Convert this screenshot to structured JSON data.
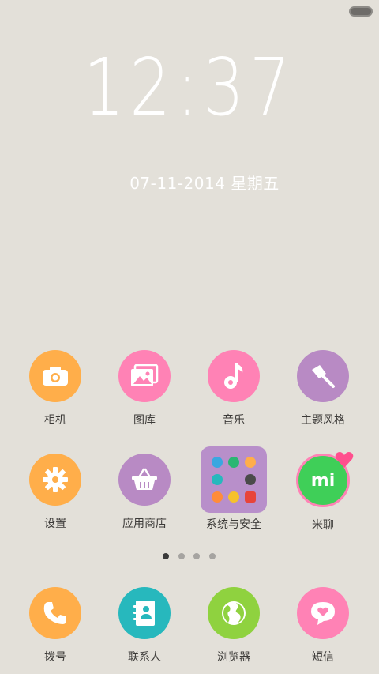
{
  "status": {
    "battery_icon": "battery-icon"
  },
  "lock": {
    "time": "12:37",
    "date": "07-11-2014 星期五"
  },
  "apps": [
    {
      "id": "camera",
      "label": "相机",
      "color": "#ffae4a",
      "icon": "camera-icon"
    },
    {
      "id": "gallery",
      "label": "图库",
      "color": "#ff82b5",
      "icon": "gallery-icon"
    },
    {
      "id": "music",
      "label": "音乐",
      "color": "#ff82b5",
      "icon": "music-note-icon"
    },
    {
      "id": "themes",
      "label": "主题风格",
      "color": "#b88ac4",
      "icon": "paint-brush-icon"
    },
    {
      "id": "settings",
      "label": "设置",
      "color": "#ffae4a",
      "icon": "gear-icon"
    },
    {
      "id": "app-store",
      "label": "应用商店",
      "color": "#b88ac4",
      "icon": "basket-icon"
    },
    {
      "id": "system-security",
      "label": "系统与安全",
      "color": "#b88fca",
      "icon": "folder-icon"
    },
    {
      "id": "mitalk",
      "label": "米聊",
      "color": "#3fcf58",
      "icon": "mitalk-icon"
    }
  ],
  "page_indicator": {
    "count": 4,
    "active": 0
  },
  "dock": [
    {
      "id": "dialer",
      "label": "拨号",
      "color": "#ffae4a",
      "icon": "phone-icon"
    },
    {
      "id": "contacts",
      "label": "联系人",
      "color": "#27b8bd",
      "icon": "contacts-book-icon"
    },
    {
      "id": "browser",
      "label": "浏览器",
      "color": "#8fd23f",
      "icon": "globe-icon"
    },
    {
      "id": "messages",
      "label": "短信",
      "color": "#ff82b5",
      "icon": "message-heart-icon"
    }
  ]
}
